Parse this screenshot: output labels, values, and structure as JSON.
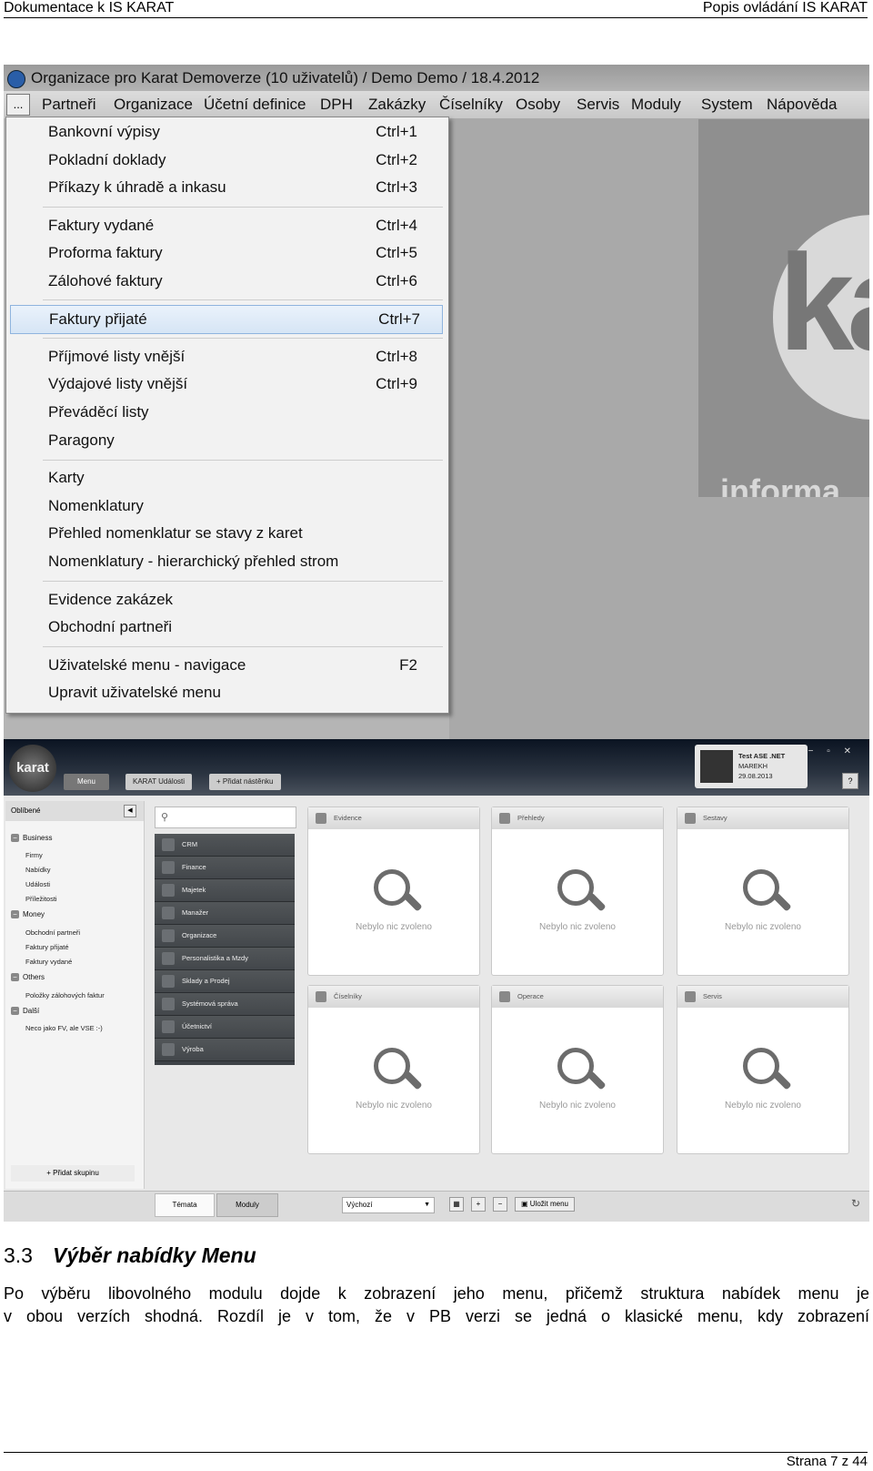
{
  "header": {
    "left": "Dokumentace k IS KARAT",
    "right": "Popis ovládání IS KARAT"
  },
  "screenshot1": {
    "window_title": "Organizace pro Karat Demoverze (10 uživatelů) / Demo Demo / 18.4.2012",
    "menu_button": "...",
    "menubar": [
      "Partneři",
      "Organizace",
      "Účetní definice",
      "DPH",
      "Zakázky",
      "Číselníky",
      "Osoby",
      "Servis",
      "Moduly",
      "System",
      "Nápověda"
    ],
    "dropdown": [
      {
        "label": "Bankovní výpisy",
        "shortcut": "Ctrl+1"
      },
      {
        "label": "Pokladní doklady",
        "shortcut": "Ctrl+2"
      },
      {
        "label": "Příkazy k úhradě a inkasu",
        "shortcut": "Ctrl+3"
      },
      {
        "label": "Faktury vydané",
        "shortcut": "Ctrl+4"
      },
      {
        "label": "Proforma faktury",
        "shortcut": "Ctrl+5"
      },
      {
        "label": "Zálohové faktury",
        "shortcut": "Ctrl+6"
      },
      {
        "label": "Faktury přijaté",
        "shortcut": "Ctrl+7"
      },
      {
        "label": "Příjmové listy vnější",
        "shortcut": "Ctrl+8"
      },
      {
        "label": "Výdajové listy vnější",
        "shortcut": "Ctrl+9"
      },
      {
        "label": "Převáděcí listy",
        "shortcut": ""
      },
      {
        "label": "Paragony",
        "shortcut": ""
      },
      {
        "label": "Karty",
        "shortcut": ""
      },
      {
        "label": "Nomenklatury",
        "shortcut": ""
      },
      {
        "label": "Přehled nomenklatur se stavy z karet",
        "shortcut": ""
      },
      {
        "label": "Nomenklatury - hierarchický přehled strom",
        "shortcut": ""
      },
      {
        "label": "Evidence zakázek",
        "shortcut": ""
      },
      {
        "label": "Obchodní partneři",
        "shortcut": ""
      },
      {
        "label": "Uživatelské menu - navigace",
        "shortcut": "F2"
      },
      {
        "label": "Upravit uživatelské menu",
        "shortcut": ""
      }
    ],
    "brand_text": "informa",
    "brand_letters": "ka"
  },
  "screenshot2": {
    "logo": "karat",
    "toolbar": {
      "menu": "Menu",
      "events": "KARAT Události",
      "add_board": "Přidat nástěnku"
    },
    "user": {
      "name": "Test ASE .NET",
      "login": "MAREKH",
      "date": "29.08.2013"
    },
    "help": "?",
    "sidebar": {
      "title": "Oblíbené",
      "groups": [
        {
          "name": "Business",
          "items": [
            "Firmy",
            "Nabídky",
            "Události",
            "Příležitosti"
          ]
        },
        {
          "name": "Money",
          "items": [
            "Obchodní partneři",
            "Faktury přijaté",
            "Faktury vydané"
          ]
        },
        {
          "name": "Others",
          "items": [
            "Položky zálohových faktur"
          ]
        },
        {
          "name": "Další",
          "items": [
            "Neco jako FV, ale VSE :-)"
          ]
        }
      ],
      "add_group": "Přidat skupinu"
    },
    "modules": [
      "CRM",
      "Finance",
      "Majetek",
      "Manažer",
      "Organizace",
      "Personalistika a Mzdy",
      "Sklady a Prodej",
      "Systémová správa",
      "Účetnictví",
      "Výroba"
    ],
    "panels": [
      {
        "title": "Evidence",
        "empty": "Nebylo nic zvoleno"
      },
      {
        "title": "Přehledy",
        "empty": "Nebylo nic zvoleno"
      },
      {
        "title": "Sestavy",
        "empty": "Nebylo nic zvoleno"
      },
      {
        "title": "Číselníky",
        "empty": "Nebylo nic zvoleno"
      },
      {
        "title": "Operace",
        "empty": "Nebylo nic zvoleno"
      },
      {
        "title": "Servis",
        "empty": "Nebylo nic zvoleno"
      }
    ],
    "bottom": {
      "tab_themes": "Témata",
      "tab_modules": "Moduly",
      "layout": "Výchozí",
      "save_menu": "Uložit menu"
    }
  },
  "section": {
    "number": "3.3",
    "title": "Výběr nabídky Menu"
  },
  "paragraph": {
    "line1": "Po výběru libovolného modulu dojde k zobrazení jeho menu, přičemž struktura nabídek menu je",
    "line2": "v obou verzích shodná. Rozdíl je v tom, že v PB verzi se jedná o klasické menu, kdy zobrazení"
  },
  "footer": "Strana 7 z 44"
}
